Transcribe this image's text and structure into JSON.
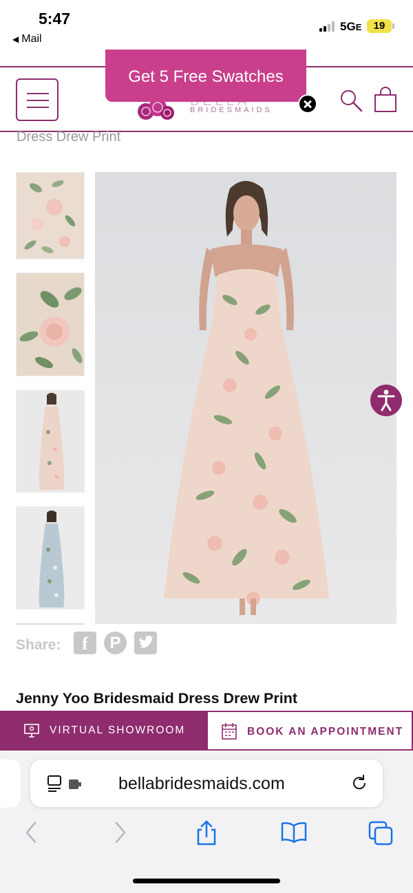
{
  "status_bar": {
    "time": "5:47",
    "back_app": "Mail",
    "network": "5G",
    "network_suffix": "E",
    "battery": "19"
  },
  "promo": {
    "label": "Get 5 Free Swatches"
  },
  "header": {
    "logo_text": "BELLA",
    "logo_subtext": "BRIDESMAIDS"
  },
  "page": {
    "crumb_title": "Dress Drew Print",
    "share_label": "Share:",
    "product_title": "Jenny Yoo Bridesmaid Dress Drew Print"
  },
  "actions": {
    "virtual_showroom": "VIRTUAL SHOWROOM",
    "book_appointment": "BOOK AN APPOINTMENT"
  },
  "browser": {
    "url": "bellabridesmaids.com"
  },
  "colors": {
    "brand_plum": "#8e2c6e",
    "promo_pink": "#c93f8c",
    "ios_blue": "#1a73e8"
  },
  "icons": {
    "menu": "hamburger-icon",
    "search": "search-icon",
    "bag": "shopping-bag-icon",
    "close": "close-icon",
    "accessibility": "accessibility-icon",
    "share": [
      "facebook-icon",
      "pinterest-icon",
      "twitter-icon"
    ],
    "showroom": "monitor-icon",
    "appointment": "calendar-icon",
    "safari": [
      "back-icon",
      "forward-icon",
      "share-icon",
      "bookmarks-icon",
      "tabs-icon"
    ]
  }
}
